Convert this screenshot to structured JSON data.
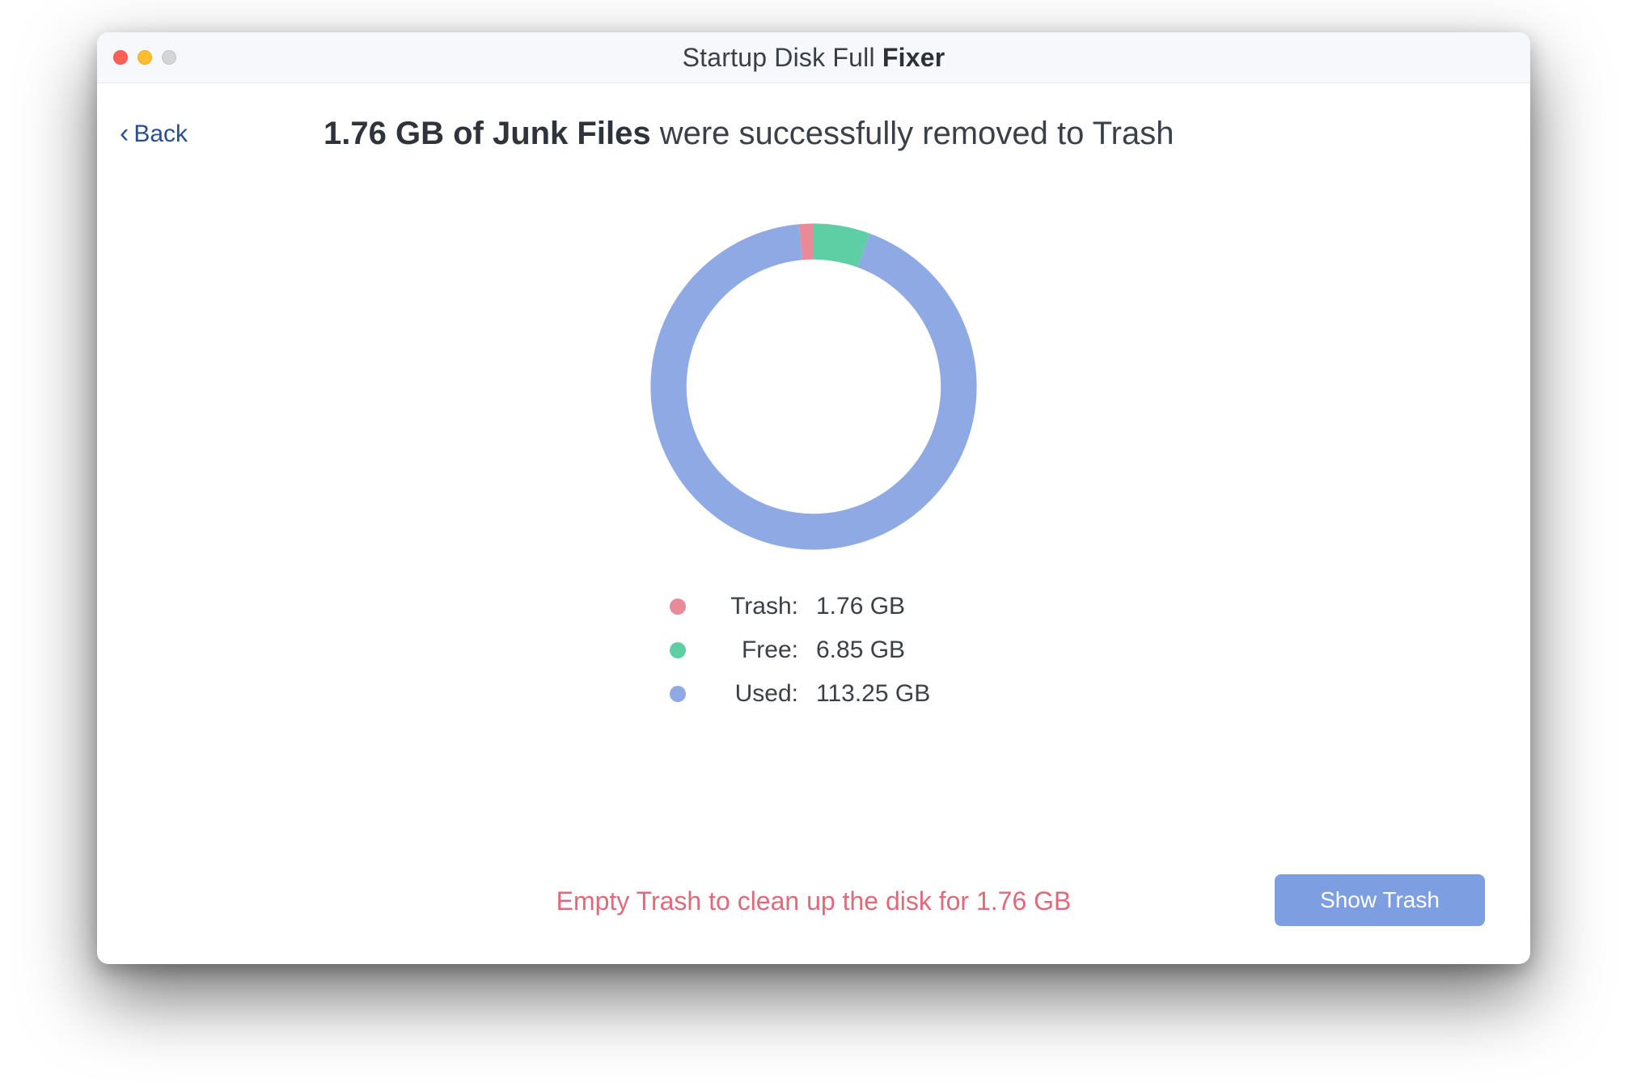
{
  "window": {
    "title_prefix": "Startup Disk Full ",
    "title_bold": "Fixer"
  },
  "nav": {
    "back_label": "Back"
  },
  "headline": {
    "bold": "1.76 GB of Junk Files",
    "rest": " were successfully removed to Trash"
  },
  "chart_data": {
    "type": "pie",
    "title": "",
    "series": [
      {
        "name": "Trash",
        "value_gb": 1.76,
        "value_label": "1.76 GB",
        "color": "#e88a98"
      },
      {
        "name": "Free",
        "value_gb": 6.85,
        "value_label": "6.85 GB",
        "color": "#5ecfa4"
      },
      {
        "name": "Used",
        "value_gb": 113.25,
        "value_label": "113.25 GB",
        "color": "#8ea9e3"
      }
    ],
    "donut_inner_ratio": 0.78
  },
  "legend": {
    "rows": [
      {
        "label": "Trash:",
        "value": "1.76 GB",
        "color": "#e88a98"
      },
      {
        "label": "Free:",
        "value": "6.85 GB",
        "color": "#5ecfa4"
      },
      {
        "label": "Used:",
        "value": "113.25 GB",
        "color": "#8ea9e3"
      }
    ]
  },
  "hint": "Empty Trash to clean up the disk for 1.76 GB",
  "actions": {
    "show_trash": "Show Trash"
  },
  "colors": {
    "accent_button": "#7d9ee0",
    "hint_text": "#e0697a",
    "title_text": "#3a3f46"
  }
}
